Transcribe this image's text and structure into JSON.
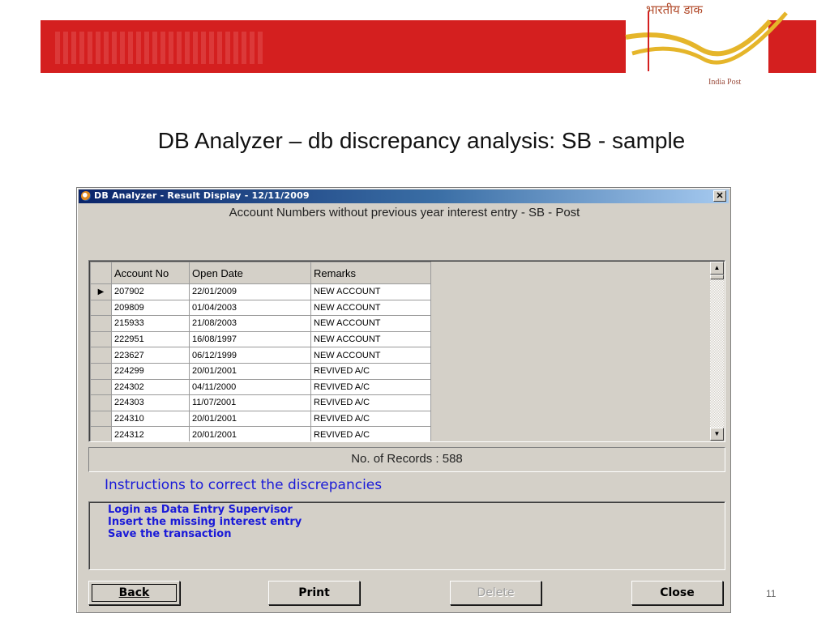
{
  "header": {
    "hindi_text": "भारतीय डाक",
    "logo_caption": "India Post",
    "brand_color": "#d41f1f"
  },
  "slide": {
    "title": "DB Analyzer – db discrepancy analysis: SB - sample",
    "number": "11"
  },
  "window": {
    "title": "DB Analyzer - Result Display - 12/11/2009",
    "close_glyph": "✕",
    "caption": "Account Numbers without previous year interest entry - SB - Post",
    "table": {
      "columns": [
        "Account No",
        "Open Date",
        "Remarks"
      ],
      "rows": [
        [
          "207902",
          "22/01/2009",
          "NEW ACCOUNT"
        ],
        [
          "209809",
          "01/04/2003",
          "NEW ACCOUNT"
        ],
        [
          "215933",
          "21/08/2003",
          "NEW ACCOUNT"
        ],
        [
          "222951",
          "16/08/1997",
          "NEW ACCOUNT"
        ],
        [
          "223627",
          "06/12/1999",
          "NEW ACCOUNT"
        ],
        [
          "224299",
          "20/01/2001",
          "REVIVED A/C"
        ],
        [
          "224302",
          "04/11/2000",
          "REVIVED A/C"
        ],
        [
          "224303",
          "11/07/2001",
          "REVIVED A/C"
        ],
        [
          "224310",
          "20/01/2001",
          "REVIVED A/C"
        ],
        [
          "224312",
          "20/01/2001",
          "REVIVED A/C"
        ]
      ],
      "selected_row": 0
    },
    "records_text": "No. of Records : 588",
    "instructions_heading": "Instructions to correct the discrepancies",
    "instructions": [
      "Login as Data Entry Supervisor",
      "Insert the missing interest entry",
      "Save the transaction"
    ],
    "buttons": {
      "back": "Back",
      "print": "Print",
      "delete": "Delete",
      "close": "Close"
    }
  }
}
